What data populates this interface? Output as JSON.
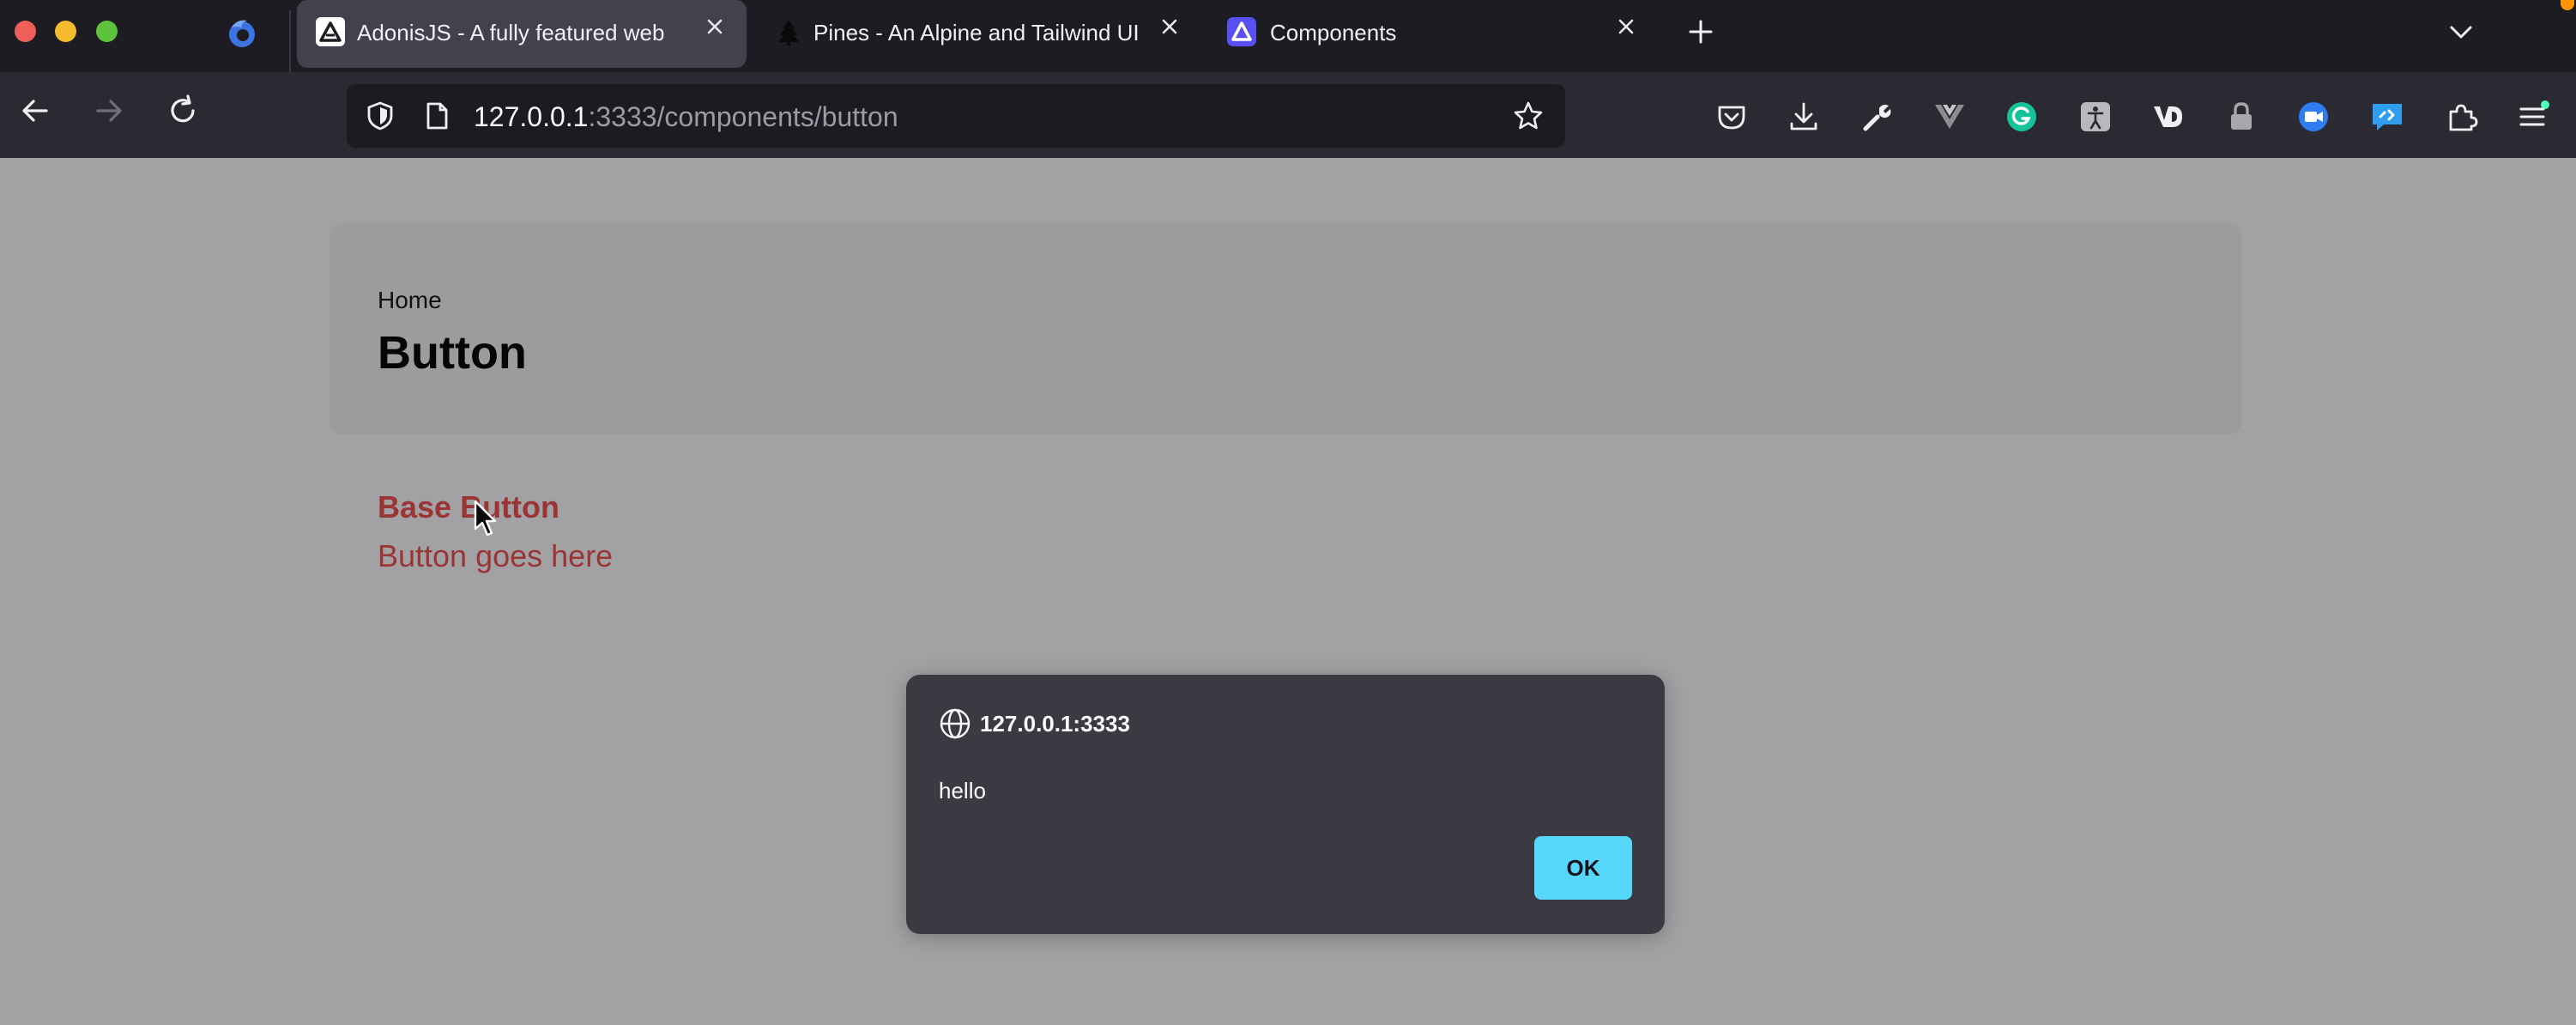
{
  "browser": {
    "tabs": [
      {
        "title": "AdonisJS - A fully featured web",
        "active": true
      },
      {
        "title": "Pines - An Alpine and Tailwind UI",
        "active": false
      },
      {
        "title": "Components",
        "active": false
      }
    ],
    "url": {
      "host": "127.0.0.1",
      "rest": ":3333/components/button"
    },
    "colors": {
      "tabstrip": "#1d1c22",
      "navbar": "#2b2a33",
      "active_tab": "#42414d"
    }
  },
  "page": {
    "breadcrumb": "Home",
    "title": "Button",
    "section": {
      "title": "Base Button",
      "body": "Button goes here"
    },
    "accent_color": "#9b3535"
  },
  "dialog": {
    "origin": "127.0.0.1:3333",
    "message": "hello",
    "ok_label": "OK",
    "button_color": "#56d8fc"
  },
  "icons": {
    "extensions": [
      "pocket-icon",
      "download-icon",
      "wrench-icon",
      "vue-devtools-icon",
      "grammarly-icon",
      "accessibility-extension-icon",
      "vd-extension-icon",
      "lock-extension-icon",
      "screen-recorder-icon",
      "chat-extension-icon",
      "extensions-puzzle-icon",
      "hamburger-menu-icon"
    ]
  }
}
